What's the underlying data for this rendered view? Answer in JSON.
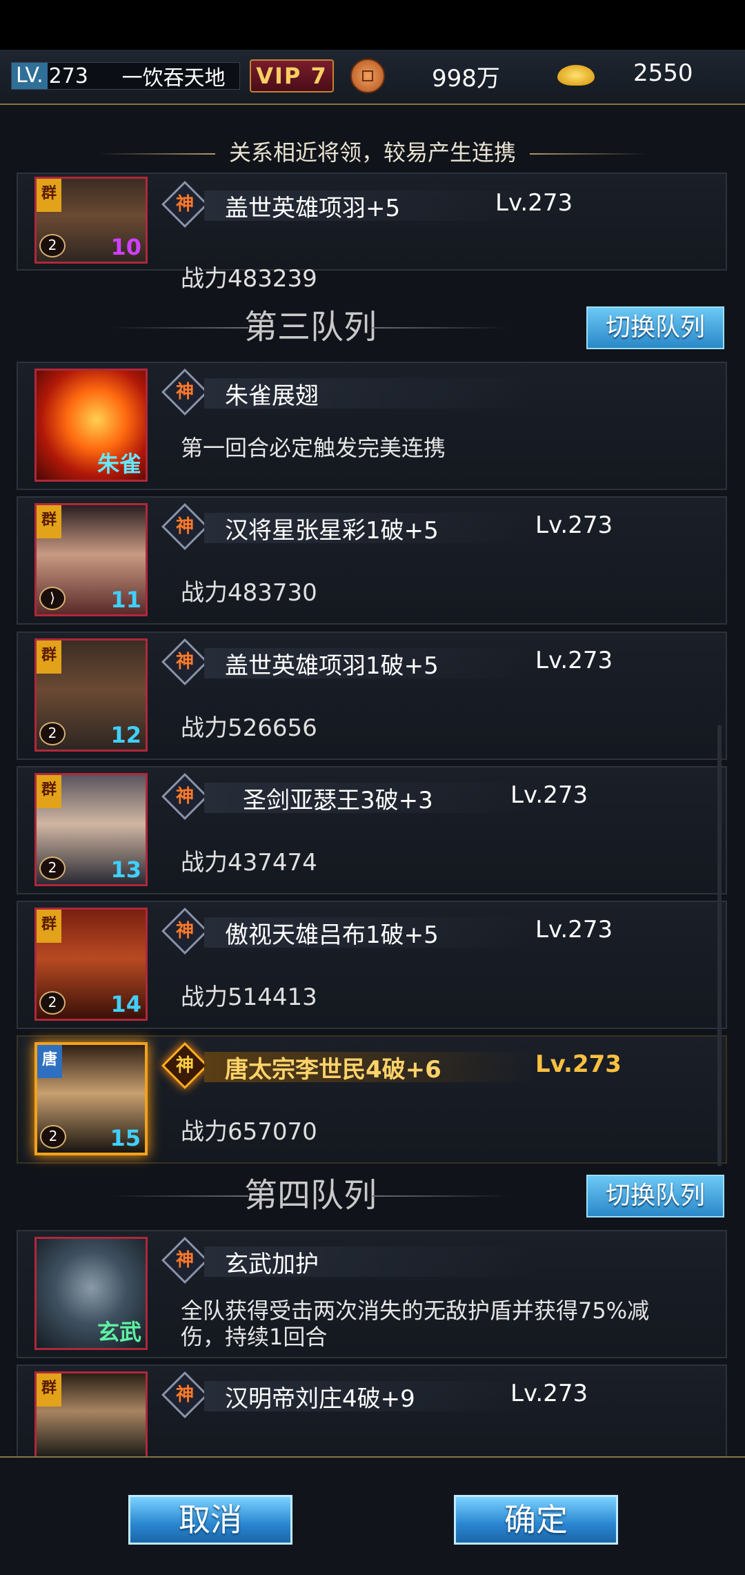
{
  "player": {
    "lv_label": "LV.",
    "level": "273",
    "name": "一饮吞天地",
    "vip": "VIP 7",
    "copper": "998万",
    "gold": "2550",
    "copper_icon": "copper-coin-icon",
    "gold_icon": "gold-ingot-icon"
  },
  "hint": "关系相近将领，较易产生连携",
  "shen_char": "神",
  "class_char": "2",
  "top_card": {
    "badge": "群",
    "number": "10",
    "name": "盖世英雄项羽+5",
    "level": "Lv.273",
    "power": "战力483239"
  },
  "team3": {
    "title": "第三队列",
    "switch_label": "切换队列",
    "beast": {
      "label": "朱雀",
      "name": "朱雀展翅",
      "desc": "第一回合必定触发完美连携"
    },
    "heroes": [
      {
        "badge": "群",
        "number": "11",
        "name": "汉将星张星彩1破+5",
        "level": "Lv.273",
        "power": "战力483730"
      },
      {
        "badge": "群",
        "number": "12",
        "name": "盖世英雄项羽1破+5",
        "level": "Lv.273",
        "power": "战力526656"
      },
      {
        "badge": "群",
        "number": "13",
        "name": "圣剑亚瑟王3破+3",
        "level": "Lv.273",
        "power": "战力437474"
      },
      {
        "badge": "群",
        "number": "14",
        "name": "傲视天雄吕布1破+5",
        "level": "Lv.273",
        "power": "战力514413"
      },
      {
        "badge": "唐",
        "number": "15",
        "name": "唐太宗李世民4破+6",
        "level": "Lv.273",
        "power": "战力657070"
      }
    ]
  },
  "team4": {
    "title": "第四队列",
    "switch_label": "切换队列",
    "beast": {
      "label": "玄武",
      "name": "玄武加护",
      "desc": "全队获得受击两次消失的无敌护盾并获得75%减伤，持续1回合"
    },
    "heroes": [
      {
        "badge": "群",
        "name": "汉明帝刘庄4破+9",
        "level": "Lv.273"
      }
    ]
  },
  "buttons": {
    "cancel": "取消",
    "confirm": "确定"
  }
}
